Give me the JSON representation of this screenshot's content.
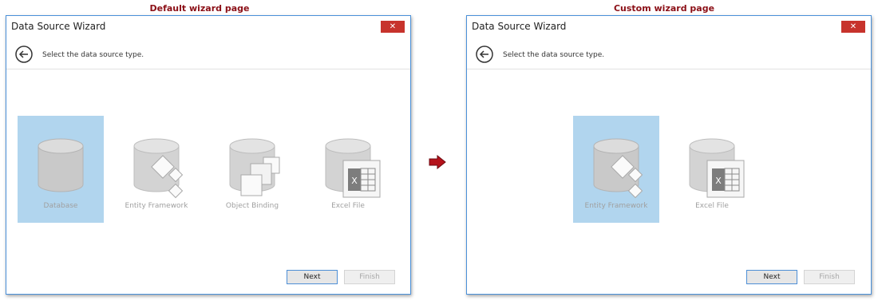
{
  "captions": {
    "left": "Default wizard page",
    "right": "Custom wizard page"
  },
  "wizard": {
    "title": "Data Source Wizard",
    "close_label": "✕",
    "header_text": "Select the data source type.",
    "next_label": "Next",
    "finish_label": "Finish"
  },
  "default_page": {
    "items": [
      {
        "label": "Database",
        "icon": "database-icon",
        "selected": true
      },
      {
        "label": "Entity Framework",
        "icon": "entity-framework-icon",
        "selected": false
      },
      {
        "label": "Object Binding",
        "icon": "object-binding-icon",
        "selected": false
      },
      {
        "label": "Excel File",
        "icon": "excel-file-icon",
        "selected": false
      }
    ]
  },
  "custom_page": {
    "items": [
      {
        "label": "Entity Framework",
        "icon": "entity-framework-icon",
        "selected": true
      },
      {
        "label": "Excel File",
        "icon": "excel-file-icon",
        "selected": false
      }
    ]
  },
  "colors": {
    "caption": "#8b0f16",
    "selected_tile": "#b1d5ee",
    "close_button": "#c7332c",
    "arrow": "#b5121b"
  }
}
